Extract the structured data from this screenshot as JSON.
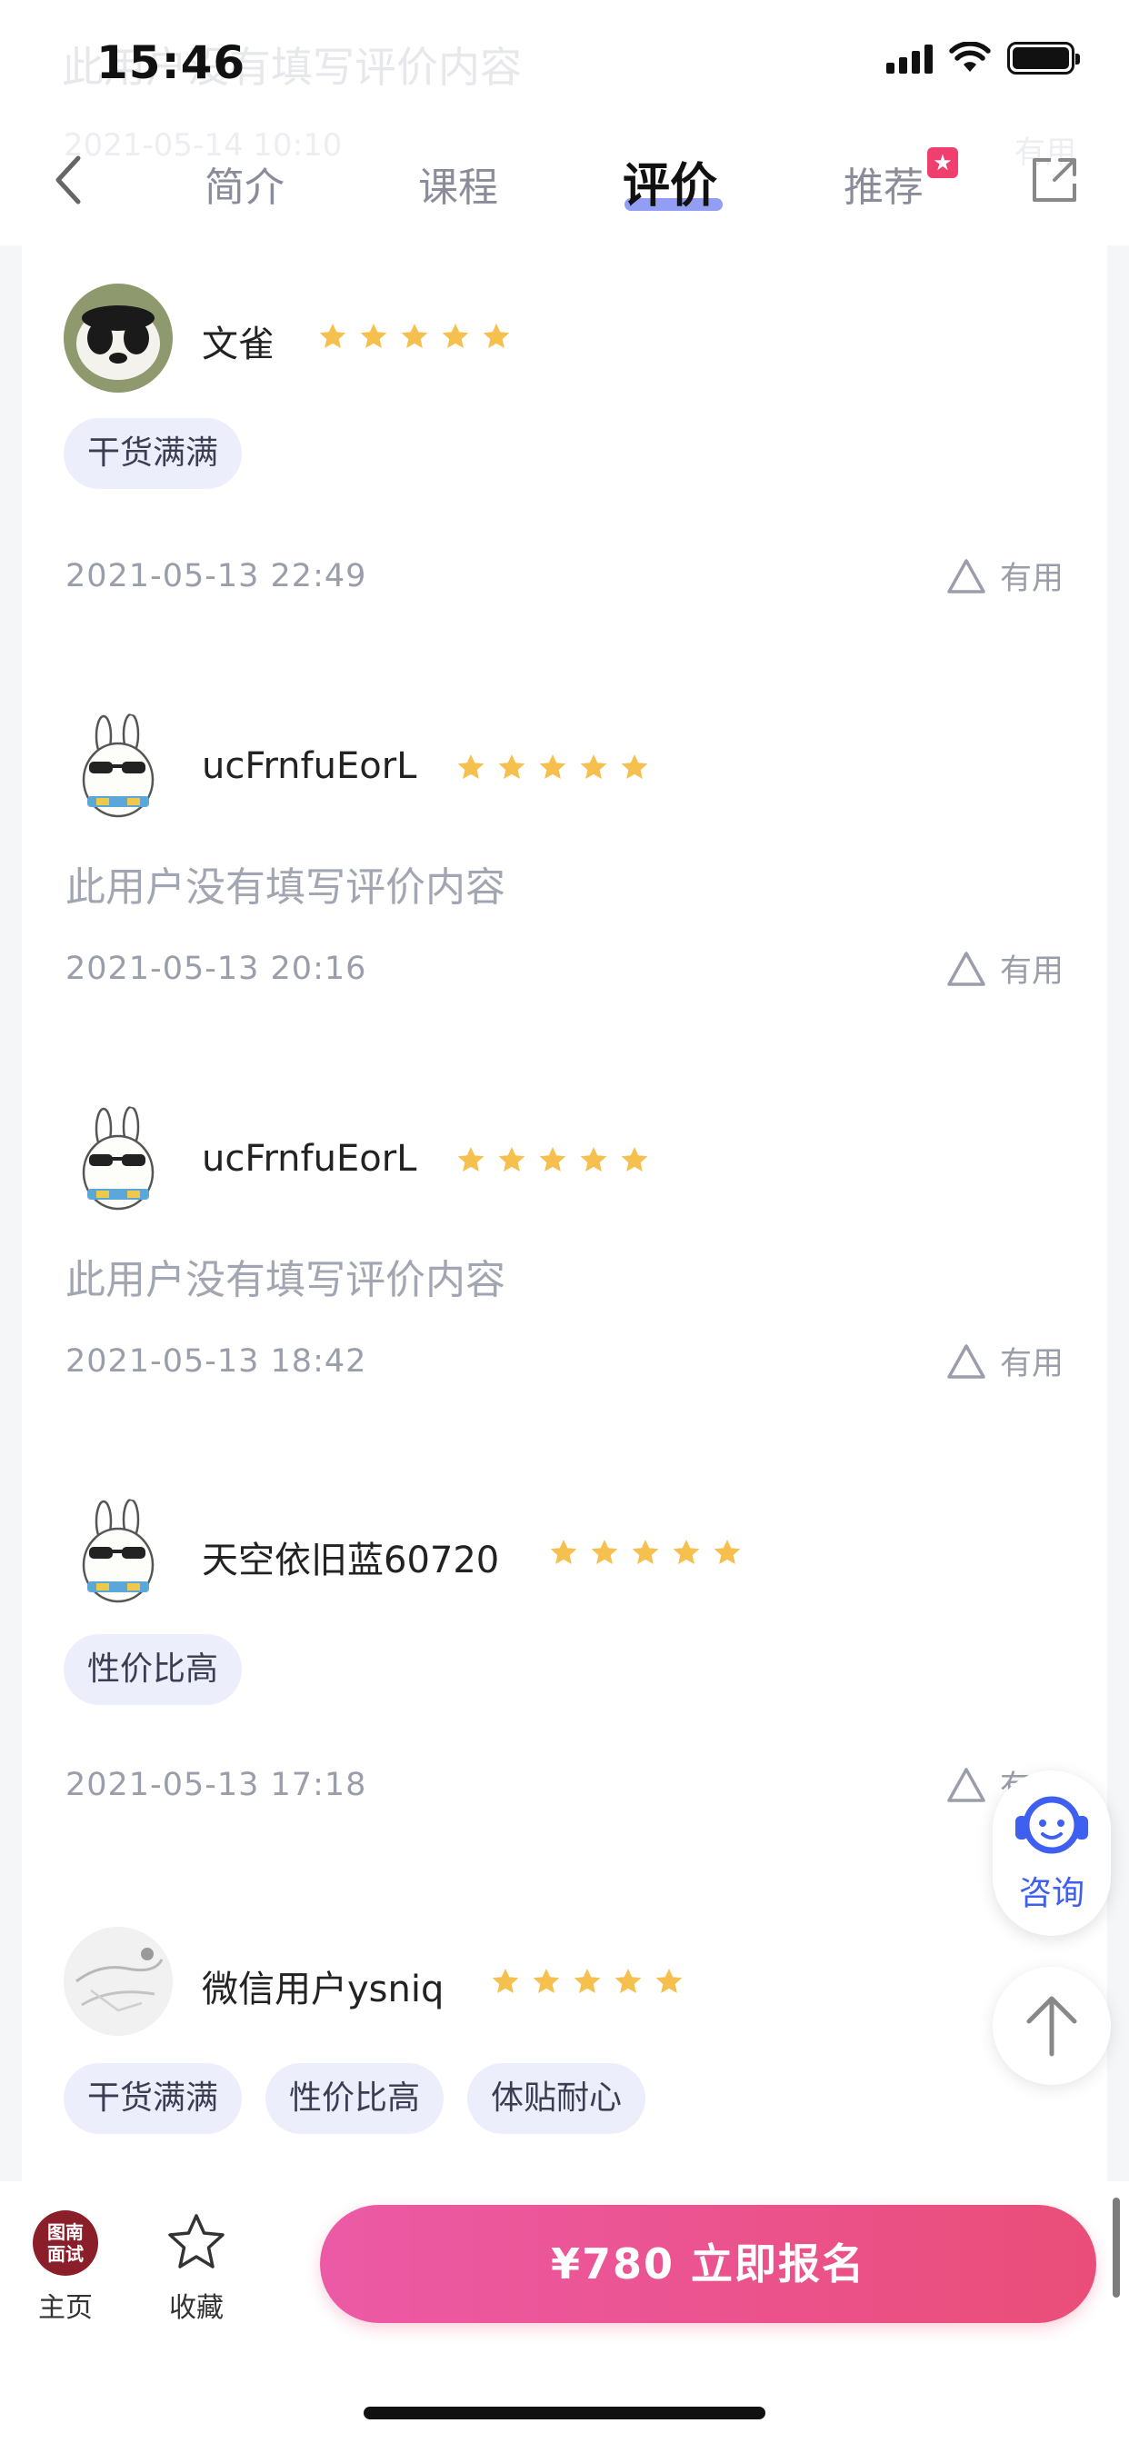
{
  "status": {
    "time": "15:46"
  },
  "ghost": {
    "content": "此用户没有填写评价内容",
    "date": "2021-05-14 10:10",
    "useful": "有用"
  },
  "nav": {
    "tabs": [
      {
        "label": "简介"
      },
      {
        "label": "课程"
      },
      {
        "label": "评价"
      },
      {
        "label": "推荐"
      }
    ],
    "active_tab": "评价"
  },
  "reviews": [
    {
      "user": "文雀",
      "rating": 5,
      "avatar": "panda-avatar",
      "tags": [
        "干货满满"
      ],
      "content": "",
      "date": "2021-05-13 22:49",
      "useful_label": "有用"
    },
    {
      "user": "ucFrnfuEorL",
      "rating": 5,
      "avatar": "rabbit-avatar",
      "tags": [],
      "content": "此用户没有填写评价内容",
      "date": "2021-05-13 20:16",
      "useful_label": "有用"
    },
    {
      "user": "ucFrnfuEorL",
      "rating": 5,
      "avatar": "rabbit-avatar",
      "tags": [],
      "content": "此用户没有填写评价内容",
      "date": "2021-05-13 18:42",
      "useful_label": "有用"
    },
    {
      "user": "天空依旧蓝60720",
      "rating": 5,
      "avatar": "rabbit-avatar",
      "tags": [
        "性价比高"
      ],
      "content": "",
      "date": "2021-05-13 17:18",
      "useful_label": "有用"
    },
    {
      "user": "微信用户ysniq",
      "rating": 5,
      "avatar": "photo-avatar",
      "tags": [
        "干货满满",
        "性价比高",
        "体贴耐心"
      ],
      "content": "",
      "date": "",
      "useful_label": ""
    }
  ],
  "floating": {
    "consult_label": "咨询"
  },
  "bottom": {
    "home_logo_text": "图南面试",
    "home_logo_line1": "图南",
    "home_logo_line2": "面试",
    "home_label": "主页",
    "favorite_label": "收藏",
    "signup_label": "¥780  立即报名"
  },
  "colors": {
    "accent": "#3f5ff0",
    "star": "#f6c04e",
    "cta_start": "#ec5aa6",
    "cta_end": "#ea4d78",
    "tag_bg": "#eceefc"
  }
}
